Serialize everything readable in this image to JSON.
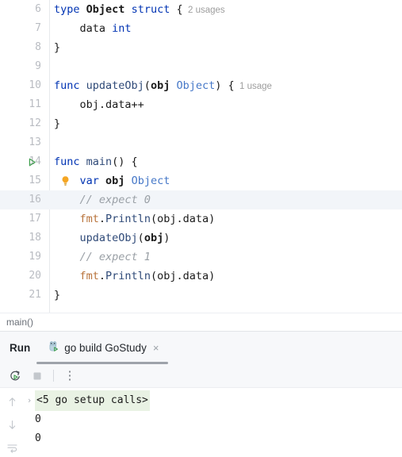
{
  "editor": {
    "lines": [
      {
        "num": "6",
        "segments": [
          {
            "t": "type ",
            "c": "kw"
          },
          {
            "t": "Object",
            "c": "ident"
          },
          {
            "t": " ",
            "c": "plain"
          },
          {
            "t": "struct",
            "c": "kw"
          },
          {
            "t": " {",
            "c": "plain"
          },
          {
            "t": "  2 usages",
            "c": "usage"
          }
        ],
        "current": false,
        "icon": ""
      },
      {
        "num": "7",
        "segments": [
          {
            "t": "    data ",
            "c": "plain"
          },
          {
            "t": "int",
            "c": "kw"
          }
        ],
        "current": false,
        "icon": ""
      },
      {
        "num": "8",
        "segments": [
          {
            "t": "}",
            "c": "plain"
          }
        ],
        "current": false,
        "icon": ""
      },
      {
        "num": "9",
        "segments": [
          {
            "t": "",
            "c": "plain"
          }
        ],
        "current": false,
        "icon": ""
      },
      {
        "num": "10",
        "segments": [
          {
            "t": "func ",
            "c": "kw"
          },
          {
            "t": "updateObj",
            "c": "fn"
          },
          {
            "t": "(",
            "c": "plain"
          },
          {
            "t": "obj",
            "c": "ident"
          },
          {
            "t": " ",
            "c": "plain"
          },
          {
            "t": "Object",
            "c": "typ"
          },
          {
            "t": ") {",
            "c": "plain"
          },
          {
            "t": "  1 usage",
            "c": "usage"
          }
        ],
        "current": false,
        "icon": ""
      },
      {
        "num": "11",
        "segments": [
          {
            "t": "    obj.data++",
            "c": "plain"
          }
        ],
        "current": false,
        "icon": ""
      },
      {
        "num": "12",
        "segments": [
          {
            "t": "}",
            "c": "plain"
          }
        ],
        "current": false,
        "icon": ""
      },
      {
        "num": "13",
        "segments": [
          {
            "t": "",
            "c": "plain"
          }
        ],
        "current": false,
        "icon": ""
      },
      {
        "num": "14",
        "segments": [
          {
            "t": "func ",
            "c": "kw"
          },
          {
            "t": "main",
            "c": "fn"
          },
          {
            "t": "() {",
            "c": "plain"
          }
        ],
        "current": false,
        "icon": "run-triangle"
      },
      {
        "num": "15",
        "segments": [
          {
            "t": "    var ",
            "c": "kw"
          },
          {
            "t": "obj",
            "c": "ident"
          },
          {
            "t": " ",
            "c": "plain"
          },
          {
            "t": "Object",
            "c": "typ"
          }
        ],
        "current": false,
        "icon": "lightbulb"
      },
      {
        "num": "16",
        "segments": [
          {
            "t": "    // expect 0",
            "c": "cmt"
          }
        ],
        "current": true,
        "icon": ""
      },
      {
        "num": "17",
        "segments": [
          {
            "t": "    ",
            "c": "plain"
          },
          {
            "t": "fmt",
            "c": "pkg"
          },
          {
            "t": ".",
            "c": "plain"
          },
          {
            "t": "Println",
            "c": "fn"
          },
          {
            "t": "(obj.data)",
            "c": "plain"
          }
        ],
        "current": false,
        "icon": ""
      },
      {
        "num": "18",
        "segments": [
          {
            "t": "    ",
            "c": "plain"
          },
          {
            "t": "updateObj",
            "c": "fn"
          },
          {
            "t": "(",
            "c": "plain"
          },
          {
            "t": "obj",
            "c": "ident"
          },
          {
            "t": ")",
            "c": "plain"
          }
        ],
        "current": false,
        "icon": ""
      },
      {
        "num": "19",
        "segments": [
          {
            "t": "    // expect 1",
            "c": "cmt"
          }
        ],
        "current": false,
        "icon": ""
      },
      {
        "num": "20",
        "segments": [
          {
            "t": "    ",
            "c": "plain"
          },
          {
            "t": "fmt",
            "c": "pkg"
          },
          {
            "t": ".",
            "c": "plain"
          },
          {
            "t": "Println",
            "c": "fn"
          },
          {
            "t": "(obj.data)",
            "c": "plain"
          }
        ],
        "current": false,
        "icon": ""
      },
      {
        "num": "21",
        "segments": [
          {
            "t": "}",
            "c": "plain"
          }
        ],
        "current": false,
        "icon": ""
      }
    ]
  },
  "breadcrumb": {
    "text": "main()"
  },
  "run_panel": {
    "title": "Run",
    "tab": {
      "label": "go build GoStudy",
      "close_label": "×"
    },
    "toolbar": {
      "rerun_title": "Rerun",
      "stop_title": "Stop",
      "more_title": "More",
      "more_glyph": "⋮"
    },
    "side_toolbar": {
      "up_glyph": "↑",
      "down_glyph": "↓",
      "wrap_title": "Soft-Wrap"
    },
    "console": {
      "lines": [
        {
          "chevron": "›",
          "text": "<5 go setup calls>",
          "folded": true
        },
        {
          "chevron": "",
          "text": "0",
          "folded": false
        },
        {
          "chevron": "",
          "text": "0",
          "folded": false
        }
      ]
    }
  },
  "colors": {
    "keyword": "#0033b3",
    "type": "#4678c8",
    "function": "#2f4a78",
    "package": "#b8733b",
    "comment": "#9aa0a6",
    "usage_hint": "#9d9d9d",
    "current_line": "#f2f5f9",
    "fold_highlight": "#e9f2e4",
    "run_green": "#3f9e4d",
    "bulb_orange": "#f5a623",
    "panel_bg": "#f7f8fa"
  }
}
